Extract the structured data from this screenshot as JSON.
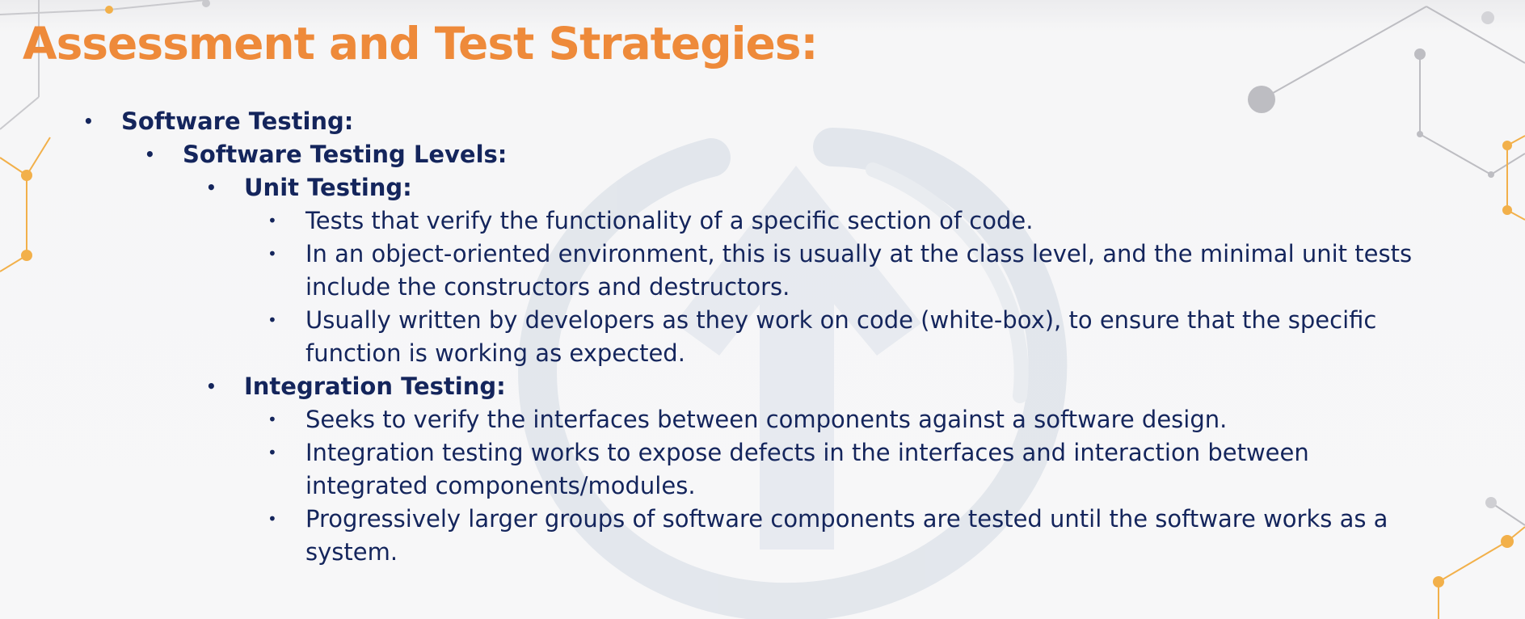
{
  "slide": {
    "title": "Assessment and Test Strategies:",
    "bullet_glyph": "•",
    "colors": {
      "title": "#ee8a3a",
      "body_text": "#14255c",
      "network_accent": "#f2b04a",
      "network_gray": "#b8b8bc"
    },
    "watermark_icon": "circular-brush-arrow-logo"
  },
  "outline": {
    "software_testing": "Software Testing:",
    "levels": "Software Testing Levels:",
    "unit": {
      "heading": "Unit Testing:",
      "b1": "Tests that verify the functionality of a specific section of code.",
      "b2_line1": "In an object-oriented environment, this is usually at the class level, and the minimal unit tests",
      "b2_line2": "include the constructors and destructors.",
      "b3_line1": "Usually written by developers as they work on code (white-box), to ensure that the specific",
      "b3_line2": "function is working as expected."
    },
    "integration": {
      "heading": "Integration Testing:",
      "b1": "Seeks to verify the interfaces between components against a software design.",
      "b2_line1": "Integration testing works to expose defects in the interfaces and interaction between",
      "b2_line2": "integrated components/modules.",
      "b3_line1": "Progressively larger groups of software components are tested until the software works as a",
      "b3_line2": "system."
    }
  }
}
